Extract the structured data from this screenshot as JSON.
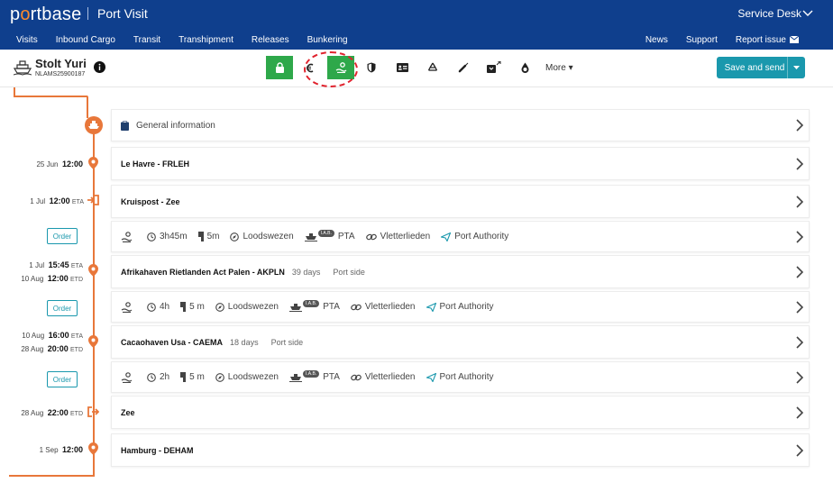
{
  "header": {
    "brand_prefix": "p",
    "brand_o": "o",
    "brand_suffix": "rtbase",
    "app_title": "Port Visit",
    "service_desk": "Service Desk",
    "nav_left": [
      "Visits",
      "Inbound Cargo",
      "Transit",
      "Transhipment",
      "Releases",
      "Bunkering"
    ],
    "nav_right": {
      "news": "News",
      "support": "Support",
      "report_issue": "Report issue"
    }
  },
  "vessel": {
    "name": "Stolt Yuri",
    "id": "NLAMS25900187"
  },
  "toolbar": {
    "icons": [
      "lock-icon",
      "euro-icon",
      "pilot-icon",
      "shield-icon",
      "id-card-icon",
      "recycle-icon",
      "syringe-icon",
      "cargo-export-icon",
      "drop-icon"
    ],
    "more_label": "More",
    "save_label": "Save and send"
  },
  "colors": {
    "brand": "#0f3f8d",
    "accent": "#e8773a",
    "green": "#2ea84a",
    "teal": "#1a98ad",
    "highlight": "#e0232e"
  },
  "timeline": [
    {
      "date": "25 Jun",
      "time": "12:00",
      "type": ""
    },
    {
      "date": "1 Jul",
      "time": "12:00",
      "type": "ETA"
    },
    {
      "date": "1 Jul",
      "time": "15:45",
      "type": "ETA"
    },
    {
      "date": "10 Aug",
      "time": "12:00",
      "type": "ETD"
    },
    {
      "date": "10 Aug",
      "time": "16:00",
      "type": "ETA"
    },
    {
      "date": "28 Aug",
      "time": "20:00",
      "type": "ETD"
    },
    {
      "date": "28 Aug",
      "time": "22:00",
      "type": "ETD"
    },
    {
      "date": "1 Sep",
      "time": "12:00",
      "type": ""
    }
  ],
  "order_label": "Order",
  "rows": {
    "general": "General information",
    "le_havre": "Le Havre - FRLEH",
    "kruispost": "Kruispost - Zee",
    "akpln": {
      "title": "Afrikahaven Rietlanden Act Palen - AKPLN",
      "days": "39 days",
      "side": "Port side"
    },
    "caema": {
      "title": "Cacaohaven Usa - CAEMA",
      "days": "18 days",
      "side": "Port side"
    },
    "zee": "Zee",
    "hamburg": "Hamburg - DEHAM"
  },
  "pilotage": [
    {
      "duration": "3h45m",
      "draught": "5m",
      "pilot": "Loodswezen",
      "tag": "I.A.B.",
      "pta": "PTA",
      "boatmen": "Vletterlieden",
      "authority": "Port Authority"
    },
    {
      "duration": "4h",
      "draught": "5 m",
      "pilot": "Loodswezen",
      "tag": "I.A.B.",
      "pta": "PTA",
      "boatmen": "Vletterlieden",
      "authority": "Port Authority"
    },
    {
      "duration": "2h",
      "draught": "5 m",
      "pilot": "Loodswezen",
      "tag": "I.A.B.",
      "pta": "PTA",
      "boatmen": "Vletterlieden",
      "authority": "Port Authority"
    }
  ]
}
